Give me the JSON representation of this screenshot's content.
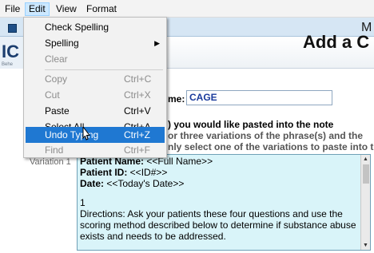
{
  "menubar": {
    "items": [
      "File",
      "Edit",
      "View",
      "Format"
    ],
    "active": "Edit"
  },
  "app": {
    "title_fragment": "M",
    "logo_letters": "IC",
    "logo_sub": "Behe",
    "page_title": "Add a C",
    "name_label": "me:",
    "name_value": "CAGE",
    "instruction_line1": ") you would like pasted into the note",
    "instruction_line2": "or three variations of the phrase(s) and the",
    "instruction_line3": "nly select one of the variations to paste into the f",
    "variation_label": "Variation 1",
    "editor": {
      "lines": [
        {
          "label": "Patient Name:",
          "value": " <<Full Name>>"
        },
        {
          "label": "Patient ID:",
          "value": " <<ID#>>"
        },
        {
          "label": "Date:",
          "value": " <<Today's Date>>"
        }
      ],
      "cursor_line": "1",
      "paragraph": "Directions: Ask your patients these four questions and use the scoring method described below to determine if substance abuse exists and needs to be addressed."
    }
  },
  "edit_menu": {
    "items": [
      {
        "label": "Check Spelling",
        "shortcut": "",
        "enabled": true,
        "submenu": false
      },
      {
        "label": "Spelling",
        "shortcut": "",
        "enabled": true,
        "submenu": true
      },
      {
        "label": "Clear",
        "shortcut": "",
        "enabled": false,
        "submenu": false
      },
      {
        "label": "Copy",
        "shortcut": "Ctrl+C",
        "enabled": false,
        "submenu": false
      },
      {
        "label": "Cut",
        "shortcut": "Ctrl+X",
        "enabled": false,
        "submenu": false
      },
      {
        "label": "Paste",
        "shortcut": "Ctrl+V",
        "enabled": true,
        "submenu": false
      },
      {
        "label": "Select All",
        "shortcut": "Ctrl+A",
        "enabled": true,
        "submenu": false
      },
      {
        "label": "Undo Typing",
        "shortcut": "Ctrl+Z",
        "enabled": true,
        "submenu": false,
        "highlighted": true
      },
      {
        "label": "Find",
        "shortcut": "Ctrl+F",
        "enabled": false,
        "submenu": false
      }
    ]
  },
  "icons": {
    "submenu_arrow": "chevron-right-icon",
    "pointer": "mouse-cursor-icon"
  },
  "colors": {
    "highlight": "#1f78d2",
    "editor_bg": "#d9f4f9",
    "name_value": "#1a3b9c"
  }
}
